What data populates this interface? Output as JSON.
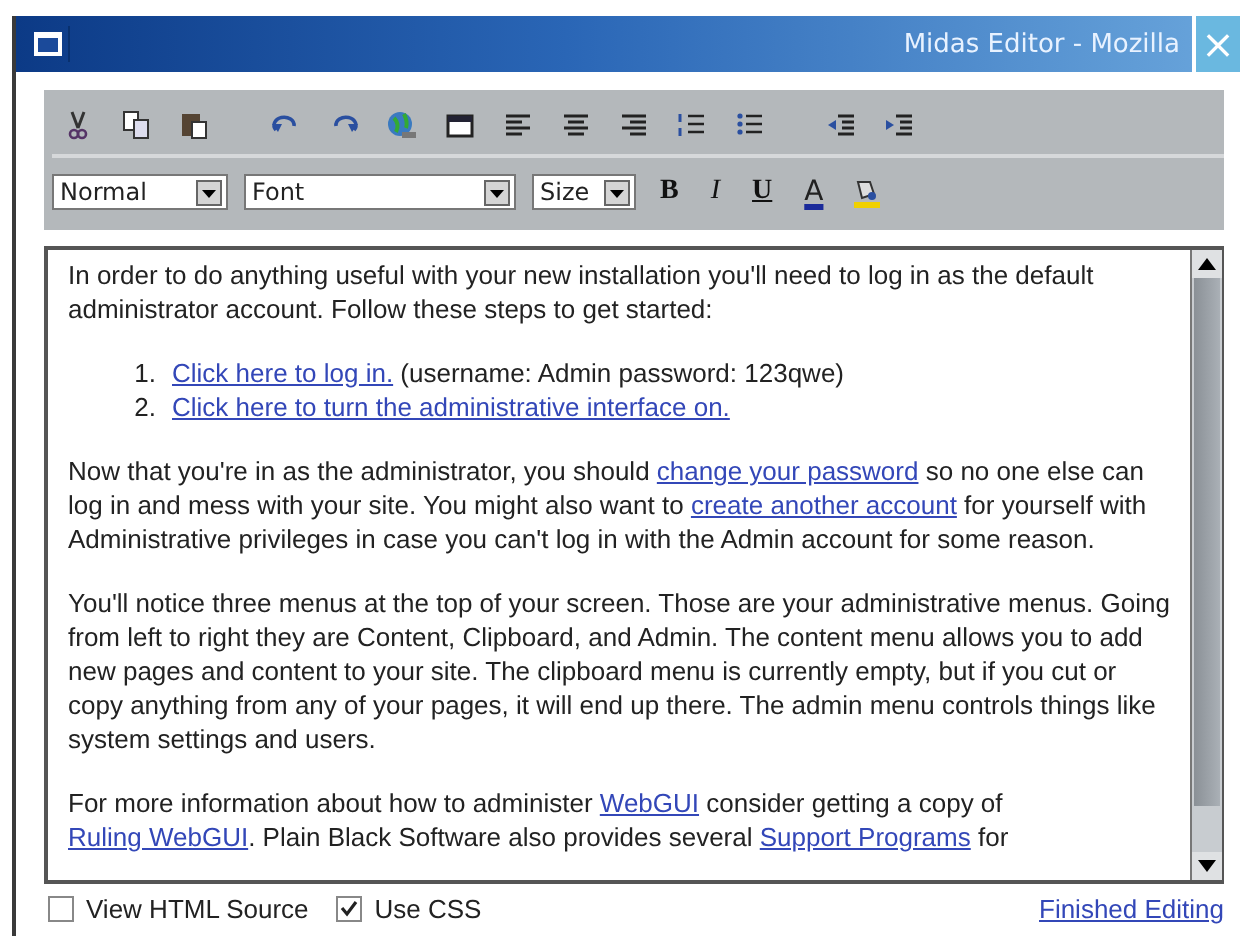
{
  "window": {
    "title": "Midas Editor - Mozilla",
    "close": "×"
  },
  "format_bar": {
    "dropdowns": [
      {
        "value": "Normal",
        "kind": "block"
      },
      {
        "value": "Font",
        "kind": "font"
      },
      {
        "value": "Size",
        "kind": "size"
      }
    ],
    "buttons": [
      {
        "kind": "bold",
        "label": "B"
      },
      {
        "kind": "italic",
        "label": "I"
      },
      {
        "kind": "underline",
        "label": "U"
      },
      {
        "kind": "color",
        "label": "A"
      },
      {
        "kind": "highlight"
      }
    ]
  },
  "document": [
    {
      "kind": "paragraph",
      "segments": [
        {
          "text": "In order to do anything useful with your new installation you'll need to log in as the default administrator account. Follow these steps to get started:",
          "kind": "text"
        }
      ]
    },
    {
      "kind": "ordered_list",
      "items": [
        {
          "number": "1.",
          "segments": [
            {
              "text": "Click here to log in.",
              "kind": "link"
            },
            {
              "text": " (username: Admin password: 123qwe)",
              "kind": "text"
            }
          ]
        },
        {
          "number": "2.",
          "segments": [
            {
              "text": "Click here to turn the administrative interface on.",
              "kind": "link"
            }
          ]
        }
      ]
    },
    {
      "kind": "paragraph",
      "segments": [
        {
          "text": "Now that you're in as the administrator, you should ",
          "kind": "text"
        },
        {
          "text": "change your password",
          "kind": "link"
        },
        {
          "text": " so no one else can log in and mess with your site. You might also want to ",
          "kind": "text"
        },
        {
          "text": "create another account",
          "kind": "link"
        },
        {
          "text": " for yourself with Administrative privileges in case you can't log in with the Admin account for some reason.",
          "kind": "text"
        }
      ]
    },
    {
      "kind": "paragraph",
      "segments": [
        {
          "text": "You'll notice three menus at the top of your screen. Those are your administrative menus. Going from left to right they are Content, Clipboard, and Admin. The content menu allows you to add new pages and content to your site. The clipboard menu is currently empty, but if you cut or copy anything from any of your pages, it will end up there. The admin menu controls things like system settings and users.",
          "kind": "text"
        }
      ]
    },
    {
      "kind": "paragraph",
      "segments": [
        {
          "text": "For more information about how to administer ",
          "kind": "text"
        },
        {
          "text": "WebGUI",
          "kind": "link"
        },
        {
          "text": " consider getting a copy of ",
          "kind": "text"
        },
        {
          "text": "Ruling WebGUI",
          "kind": "link"
        },
        {
          "text": ". Plain Black Software also provides several ",
          "kind": "text"
        },
        {
          "text": "Support Programs",
          "kind": "link"
        },
        {
          "text": " for",
          "kind": "text"
        }
      ]
    }
  ],
  "options": [
    {
      "label": "View HTML Source",
      "checked": false
    },
    {
      "label": "Use CSS",
      "checked": true
    }
  ],
  "finish_link": "Finished Editing"
}
